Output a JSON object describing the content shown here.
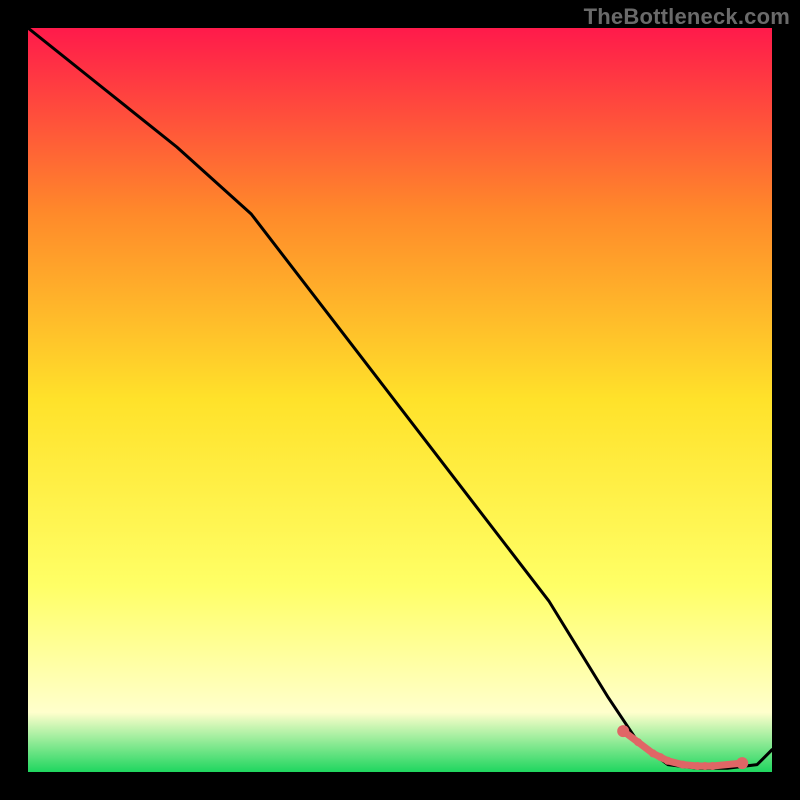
{
  "watermark": "TheBottleneck.com",
  "colors": {
    "background": "#000000",
    "line": "#000000",
    "marker": "#e06666",
    "grad_top": "#ff1a4b",
    "grad_mid_upper": "#ff8a2a",
    "grad_mid": "#ffe22a",
    "grad_mid_lower": "#ffff66",
    "grad_lower_pale": "#ffffcc",
    "grad_bottom": "#1fd65f"
  },
  "chart_data": {
    "type": "line",
    "xlim": [
      0,
      100
    ],
    "ylim": [
      0,
      100
    ],
    "title": "",
    "xlabel": "",
    "ylabel": "",
    "series": [
      {
        "name": "bottleneck-curve",
        "x": [
          0,
          10,
          20,
          30,
          40,
          50,
          60,
          70,
          78,
          82,
          86,
          90,
          94,
          98,
          100
        ],
        "y": [
          100,
          92,
          84,
          75,
          62,
          49,
          36,
          23,
          10,
          4,
          1,
          0.5,
          0.5,
          1,
          3
        ]
      }
    ],
    "markers": {
      "name": "highlight-points",
      "x": [
        80,
        82,
        84,
        85,
        86,
        88,
        90,
        91,
        92,
        96
      ],
      "y": [
        5.5,
        4.0,
        2.5,
        2.0,
        1.5,
        1.0,
        0.8,
        0.8,
        0.8,
        1.2
      ]
    }
  }
}
